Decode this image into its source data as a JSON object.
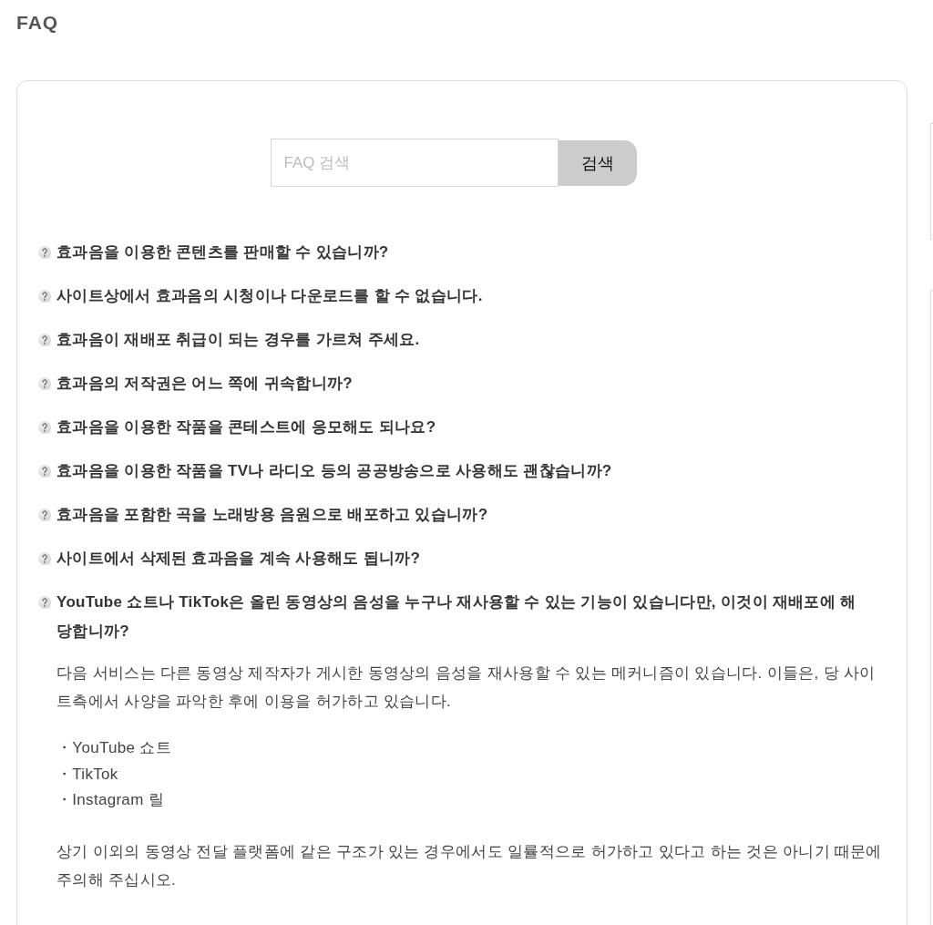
{
  "page": {
    "title": "FAQ"
  },
  "search": {
    "placeholder": "FAQ 검색",
    "button": "검색"
  },
  "questions": [
    {
      "text": "효과음을 이용한 콘텐츠를 판매할 수 있습니까?"
    },
    {
      "text": "사이트상에서 효과음의 시청이나 다운로드를 할 수 없습니다."
    },
    {
      "text": "효과음이 재배포 취급이 되는 경우를 가르쳐 주세요."
    },
    {
      "text": "효과음의 저작권은 어느 쪽에 귀속합니까?"
    },
    {
      "text": "효과음을 이용한 작품을 콘테스트에 응모해도 되나요?"
    },
    {
      "text": "효과음을 이용한 작품을 TV나 라디오 등의 공공방송으로 사용해도 괜찮습니까?"
    },
    {
      "text": "효과음을 포함한 곡을 노래방용 음원으로 배포하고 있습니까?"
    },
    {
      "text": "사이트에서 삭제된 효과음을 계속 사용해도 됩니까?"
    },
    {
      "text": "YouTube 쇼트나 TikTok은 올린 동영상의 음성을 누구나 재사용할 수 있는 기능이 있습니다만, 이것이 재배포에 해당합니까?",
      "answer": [
        {
          "kind": "paragraph",
          "text": "다음 서비스는 다른 동영상 제작자가 게시한 동영상의 음성을 재사용할 수 있는 메커니즘이 있습니다. 이들은, 당 사이트측에서 사양을 파악한 후에 이용을 허가하고 있습니다."
        },
        {
          "kind": "list",
          "items": [
            "・YouTube 쇼트",
            "・TikTok",
            "・Instagram 릴"
          ]
        },
        {
          "kind": "paragraph",
          "text": "상기 이외의 동영상 전달 플랫폼에 같은 구조가 있는 경우에서도 일률적으로 허가하고 있다고 하는 것은 아니기 때문에 주의해 주십시오."
        }
      ]
    }
  ]
}
